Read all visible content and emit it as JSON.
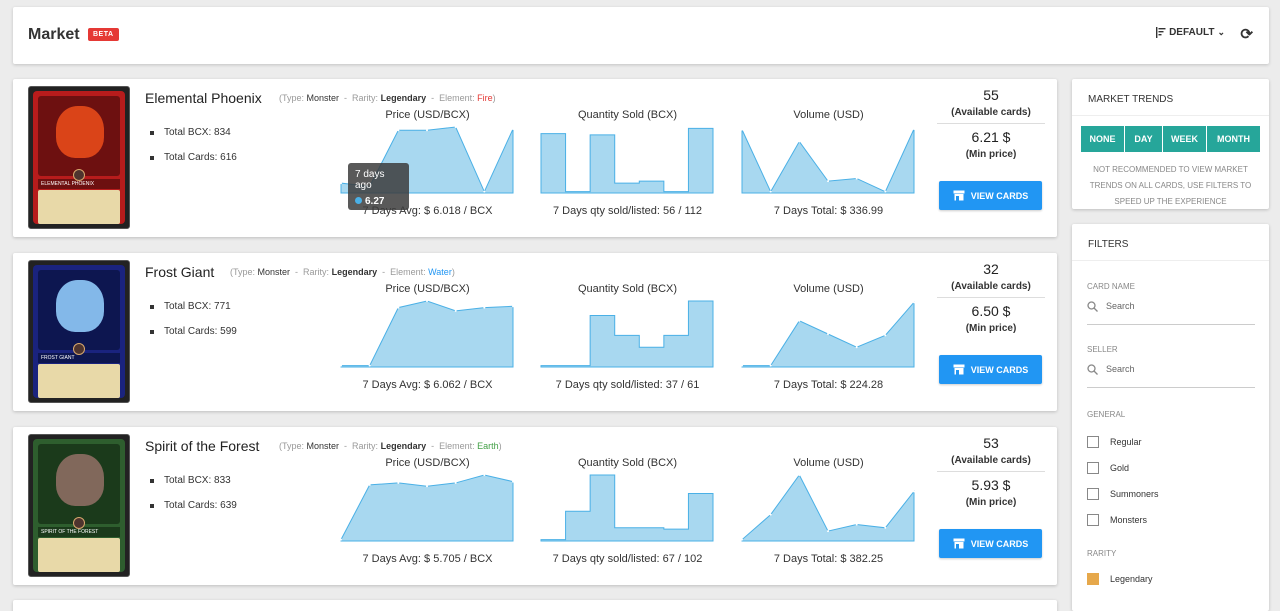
{
  "header": {
    "title": "Market",
    "badge": "BETA",
    "sort_label": "DEFAULT",
    "sort_icon": "sort-icon",
    "refresh_icon": "refresh-icon"
  },
  "cards": [
    {
      "name": "Elemental Phoenix",
      "type_label": "(Type:",
      "type": "Monster",
      "rarity_label": "Rarity:",
      "rarity": "Legendary",
      "element_label": "Element:",
      "element": "Fire",
      "element_color": "#e53935",
      "card_label": "ELEMENTAL PHOENIX",
      "total_bcx_label": "Total BCX:",
      "total_bcx": "834",
      "total_cards_label": "Total Cards:",
      "total_cards": "616",
      "price_title": "Price (USD/BCX)",
      "price_foot_label": "7 Days Avg:",
      "price_foot_value": "$ 6.018 / BCX",
      "qty_title": "Quantity Sold (BCX)",
      "qty_foot_label": "7 Days qty sold/listed:",
      "qty_foot_value": "56 / 112",
      "vol_title": "Volume (USD)",
      "vol_foot_label": "7 Days Total:",
      "vol_foot_value": "$ 336.99",
      "available": "55",
      "available_label": "(Available cards)",
      "min_price": "6.21 $",
      "min_price_label": "(Min price)",
      "button": "VIEW CARDS",
      "price_series": [
        0.15,
        0.1,
        0.95,
        0.95,
        1.0,
        0.02,
        0.97
      ],
      "qty_series": [
        0.9,
        0.02,
        0.88,
        0.15,
        0.18,
        0.02,
        0.98
      ],
      "vol_series": [
        0.96,
        0.02,
        0.78,
        0.18,
        0.22,
        0.02,
        0.97
      ],
      "tooltip_title": "7 days ago",
      "tooltip_value": "6.27"
    },
    {
      "name": "Frost Giant",
      "type_label": "(Type:",
      "type": "Monster",
      "rarity_label": "Rarity:",
      "rarity": "Legendary",
      "element_label": "Element:",
      "element": "Water",
      "element_color": "#2196f3",
      "card_label": "FROST GIANT",
      "total_bcx_label": "Total BCX:",
      "total_bcx": "771",
      "total_cards_label": "Total Cards:",
      "total_cards": "599",
      "price_title": "Price (USD/BCX)",
      "price_foot_label": "7 Days Avg:",
      "price_foot_value": "$ 6.062 / BCX",
      "qty_title": "Quantity Sold (BCX)",
      "qty_foot_label": "7 Days qty sold/listed:",
      "qty_foot_value": "37 / 61",
      "vol_title": "Volume (USD)",
      "vol_foot_label": "7 Days Total:",
      "vol_foot_value": "$ 224.28",
      "available": "32",
      "available_label": "(Available cards)",
      "min_price": "6.50 $",
      "min_price_label": "(Min price)",
      "button": "VIEW CARDS",
      "price_series": [
        0.02,
        0.02,
        0.9,
        1.0,
        0.85,
        0.9,
        0.92
      ],
      "qty_series": [
        0.02,
        0.02,
        0.78,
        0.48,
        0.3,
        0.48,
        1.0
      ],
      "vol_series": [
        0.02,
        0.02,
        0.7,
        0.5,
        0.3,
        0.48,
        0.98
      ],
      "tooltip_title": "",
      "tooltip_value": ""
    },
    {
      "name": "Spirit of the Forest",
      "type_label": "(Type:",
      "type": "Monster",
      "rarity_label": "Rarity:",
      "rarity": "Legendary",
      "element_label": "Element:",
      "element": "Earth",
      "element_color": "#43a047",
      "card_label": "SPIRIT OF THE FOREST",
      "total_bcx_label": "Total BCX:",
      "total_bcx": "833",
      "total_cards_label": "Total Cards:",
      "total_cards": "639",
      "price_title": "Price (USD/BCX)",
      "price_foot_label": "7 Days Avg:",
      "price_foot_value": "$ 5.705 / BCX",
      "qty_title": "Quantity Sold (BCX)",
      "qty_foot_label": "7 Days qty sold/listed:",
      "qty_foot_value": "67 / 102",
      "vol_title": "Volume (USD)",
      "vol_foot_label": "7 Days Total:",
      "vol_foot_value": "$ 382.25",
      "available": "53",
      "available_label": "(Available cards)",
      "min_price": "5.93 $",
      "min_price_label": "(Min price)",
      "button": "VIEW CARDS",
      "price_series": [
        0.02,
        0.85,
        0.88,
        0.83,
        0.88,
        1.0,
        0.9
      ],
      "qty_series": [
        0.02,
        0.45,
        1.0,
        0.2,
        0.2,
        0.18,
        0.72
      ],
      "vol_series": [
        0.02,
        0.4,
        1.0,
        0.15,
        0.25,
        0.2,
        0.75
      ],
      "tooltip_title": "",
      "tooltip_value": ""
    }
  ],
  "trends": {
    "title": "MARKET TRENDS",
    "buttons": [
      "NONE",
      "DAY",
      "WEEK",
      "MONTH"
    ],
    "note": "NOT RECOMMENDED TO VIEW MARKET TRENDS ON ALL CARDS, USE FILTERS TO SPEED UP THE EXPERIENCE"
  },
  "filters": {
    "title": "FILTERS",
    "card_name_label": "CARD NAME",
    "card_name_placeholder": "Search",
    "seller_label": "SELLER",
    "seller_placeholder": "Search",
    "general_label": "GENERAL",
    "general_options": [
      "Regular",
      "Gold",
      "Summoners",
      "Monsters"
    ],
    "rarity_label": "RARITY",
    "rarity_options": [
      "Legendary"
    ]
  },
  "colors": {
    "accent": "#2196f3",
    "teal": "#26a69a",
    "chart_fill": "#a8d8f0",
    "chart_line": "#4ab0e6"
  }
}
